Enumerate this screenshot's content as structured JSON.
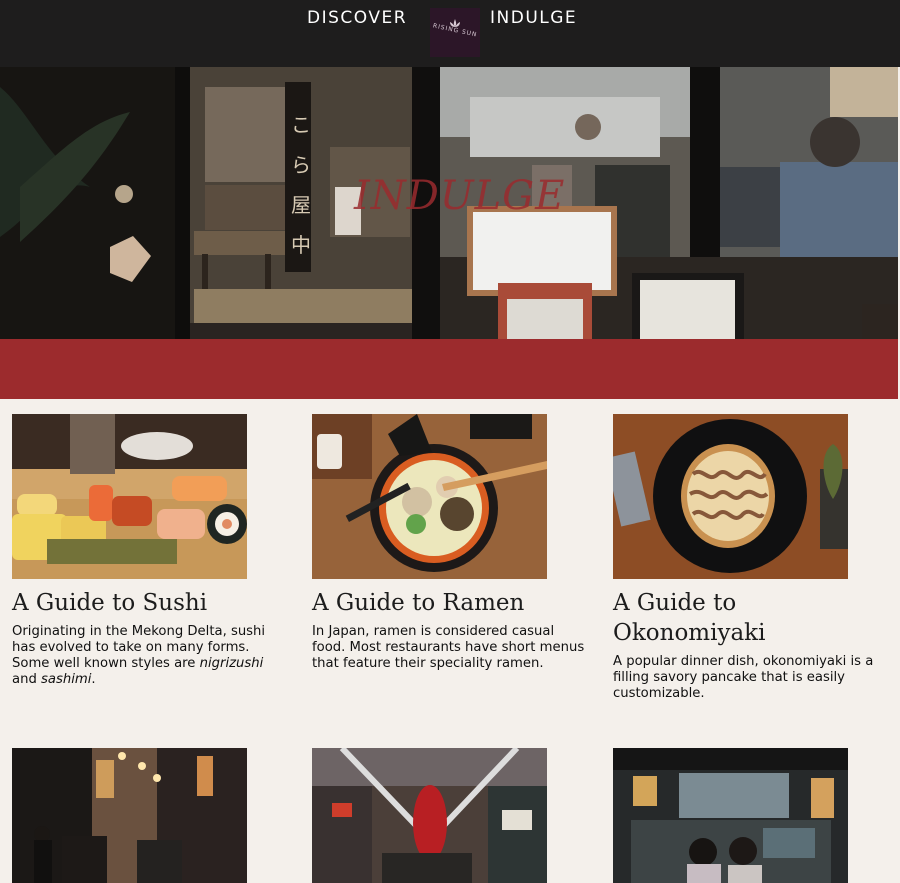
{
  "nav": {
    "left_label": "DISCOVER",
    "right_label": "INDULGE",
    "logo_text": "RISING SUN"
  },
  "hero": {
    "title": "INDULGE",
    "image": "izakaya restaurant storefront photo"
  },
  "colors": {
    "topbar": "#1e1d1d",
    "accent_red": "#9c2b2d",
    "page_bg": "#f4f0eb",
    "logo_bg": "#2c1628"
  },
  "guides": [
    {
      "image": "sushi platter photo",
      "title": "A Guide to Sushi",
      "text_parts": [
        "Originating in the Mekong Delta, sushi has evolved to take on many forms. Some well known styles are ",
        "nigrizushi",
        " and ",
        "sashimi",
        "."
      ]
    },
    {
      "image": "ramen bowl photo",
      "title": "A Guide to Ramen",
      "text": "In Japan, ramen is considered casual food. Most restaurants have short menus that feature their speciality ramen."
    },
    {
      "image": "okonomiyaki plate photo",
      "title": "A Guide to Okonomiyaki",
      "text": "A popular dinner dish, okonomiyaki is a filling savory pancake that is easily customizable."
    }
  ],
  "gallery": [
    {
      "image": "night market street photo"
    },
    {
      "image": "shopping arcade with red lantern photo"
    },
    {
      "image": "food stall storefront photo"
    }
  ]
}
